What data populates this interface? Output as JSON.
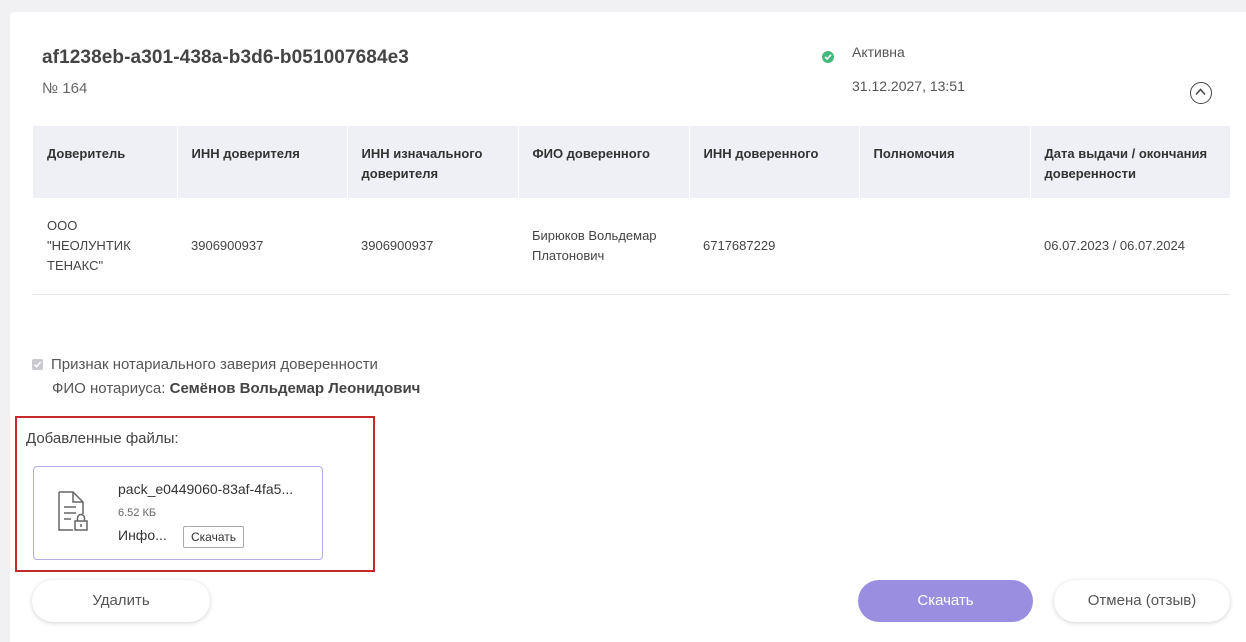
{
  "header": {
    "id": "af1238eb-a301-438a-b3d6-b051007684e3",
    "number": "№ 164",
    "status": "Активна",
    "date": "31.12.2027, 13:51"
  },
  "table": {
    "columns": [
      "Доверитель",
      "ИНН доверителя",
      "ИНН изначального доверителя",
      "ФИО доверенного",
      "ИНН доверенного",
      "Полномочия",
      "Дата выдачи / окончания доверенности"
    ],
    "rows": [
      [
        "ООО \"НЕОЛУНТИК ТЕНАКС\"",
        "3906900937",
        "3906900937",
        "Бирюков Вольдемар Платонович",
        "6717687229",
        "",
        "06.07.2023 / 06.07.2024"
      ]
    ]
  },
  "notary": {
    "checkbox_label": "Признак нотариального заверия доверенности",
    "name_label": "ФИО нотариуса:",
    "name_value": "Семёнов Вольдемар Леонидович"
  },
  "files": {
    "title": "Добавленные файлы:",
    "items": [
      {
        "name": "pack_e0449060-83af-4fa5...",
        "size": "6.52 КБ",
        "info": "Инфо...",
        "download_label": "Скачать"
      }
    ]
  },
  "actions": {
    "delete_label": "Удалить",
    "download_label": "Скачать",
    "cancel_label": "Отмена (отзыв)"
  },
  "colors": {
    "accent": "#9a8ee0",
    "status_active": "#43b87c",
    "highlight": "#c42a2a"
  }
}
